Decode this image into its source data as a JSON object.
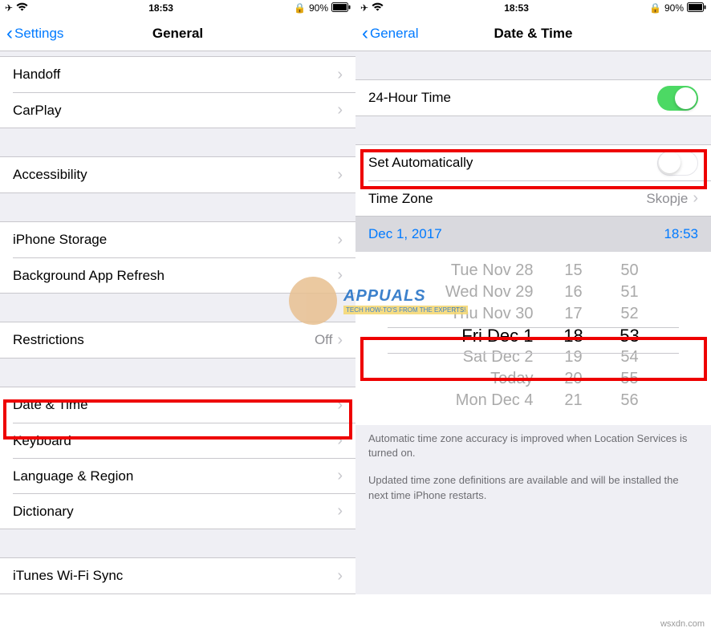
{
  "status": {
    "time": "18:53",
    "battery_pct": "90%"
  },
  "left": {
    "back": "Settings",
    "title": "General",
    "rows": {
      "handoff": "Handoff",
      "carplay": "CarPlay",
      "accessibility": "Accessibility",
      "iphone_storage": "iPhone Storage",
      "background_refresh": "Background App Refresh",
      "restrictions": "Restrictions",
      "restrictions_val": "Off",
      "date_time": "Date & Time",
      "keyboard": "Keyboard",
      "language_region": "Language & Region",
      "dictionary": "Dictionary",
      "itunes_wifi": "iTunes Wi-Fi Sync"
    }
  },
  "right": {
    "back": "General",
    "title": "Date & Time",
    "rows": {
      "twentyfour": "24-Hour Time",
      "set_auto": "Set Automatically",
      "timezone": "Time Zone",
      "timezone_val": "Skopje"
    },
    "selected_date": "Dec 1, 2017",
    "selected_time": "18:53",
    "picker": {
      "dates": [
        "Tue Nov 28",
        "Wed Nov 29",
        "Thu Nov 30",
        "Fri Dec 1",
        "Sat Dec 2",
        "Today",
        "Mon Dec 4"
      ],
      "hours": [
        "15",
        "16",
        "17",
        "18",
        "19",
        "20",
        "21"
      ],
      "mins": [
        "50",
        "51",
        "52",
        "53",
        "54",
        "55",
        "56"
      ]
    },
    "footer1": "Automatic time zone accuracy is improved when Location Services is turned on.",
    "footer2": "Updated time zone definitions are available and will be installed the next time iPhone restarts."
  },
  "watermark": "wsxdn.com",
  "appuals": {
    "name": "APPUALS",
    "sub": "TECH HOW-TO'S FROM THE EXPERTS!"
  }
}
